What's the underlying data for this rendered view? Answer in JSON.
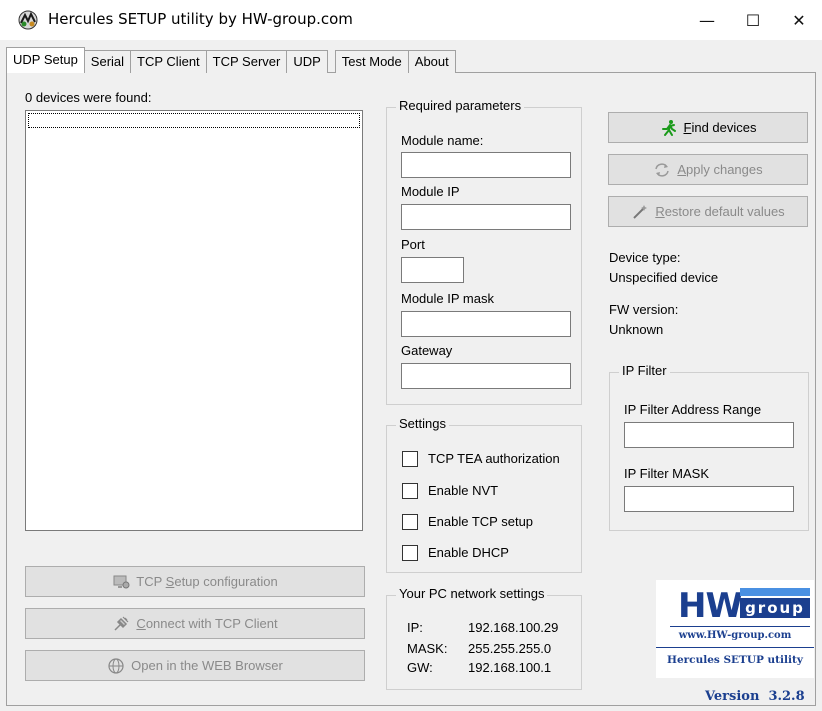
{
  "window": {
    "title": "Hercules SETUP utility by HW-group.com",
    "minimize_glyph": "—",
    "maximize_glyph": "☐",
    "close_glyph": "✕"
  },
  "tabs": [
    {
      "label": "UDP Setup",
      "active": true
    },
    {
      "label": "Serial",
      "active": false
    },
    {
      "label": "TCP Client",
      "active": false
    },
    {
      "label": "TCP Server",
      "active": false
    },
    {
      "label": "UDP",
      "active": false
    },
    {
      "label": "Test Mode",
      "active": false
    },
    {
      "label": "About",
      "active": false
    }
  ],
  "devices": {
    "found_label": "0 devices were found:"
  },
  "left_buttons": {
    "tcp_setup": {
      "pre": "TCP ",
      "accel": "S",
      "post": "etup configuration",
      "icon": "monitor-gear-icon"
    },
    "connect_tcp": {
      "pre": "",
      "accel": "C",
      "post": "onnect with TCP Client",
      "icon": "plug-icon"
    },
    "open_web": {
      "pre": "",
      "accel": "",
      "post": "Open in the WEB Browser",
      "icon": "globe-icon"
    }
  },
  "required_parameters": {
    "title": "Required parameters",
    "module_name_label": "Module name:",
    "module_name_value": "",
    "module_ip_label": "Module IP",
    "module_ip_value": "",
    "port_label": "Port",
    "port_value": "",
    "module_ip_mask_label": "Module IP mask",
    "module_ip_mask_value": "",
    "gateway_label": "Gateway",
    "gateway_value": ""
  },
  "settings": {
    "title": "Settings",
    "options": [
      {
        "label": "TCP TEA authorization",
        "checked": false
      },
      {
        "label": "Enable NVT",
        "checked": false
      },
      {
        "label": "Enable TCP setup",
        "checked": false
      },
      {
        "label": "Enable DHCP",
        "checked": false
      }
    ]
  },
  "pc_network": {
    "title": "Your PC network settings",
    "ip_label": "IP:",
    "ip_value": "192.168.100.29",
    "mask_label": "MASK:",
    "mask_value": "255.255.255.0",
    "gw_label": "GW:",
    "gw_value": "192.168.100.1"
  },
  "right_buttons": {
    "find_devices": {
      "accel": "F",
      "post": "ind devices",
      "icon": "running-man-icon"
    },
    "apply_changes": {
      "accel": "A",
      "post": "pply changes",
      "icon": "refresh-icon"
    },
    "restore_defaults": {
      "accel": "R",
      "post": "estore default values",
      "icon": "wand-icon"
    }
  },
  "device_info": {
    "device_type_label": "Device type:",
    "device_type_value": "Unspecified device",
    "fw_version_label": "FW version:",
    "fw_version_value": "Unknown"
  },
  "ip_filter": {
    "title": "IP Filter",
    "address_range_label": "IP Filter Address Range",
    "address_range_value": "",
    "mask_label": "IP Filter MASK",
    "mask_value": ""
  },
  "logo": {
    "hw_text": "HW",
    "group_text": "group",
    "url_text": "www.HW-group.com",
    "product_text": "Hercules SETUP utility",
    "version_text": "Version  3.2.8"
  },
  "colors": {
    "logo_blue": "#1b3f8f",
    "find_icon_green": "#1a9a1a",
    "disabled_text": "#8a8a8a"
  }
}
